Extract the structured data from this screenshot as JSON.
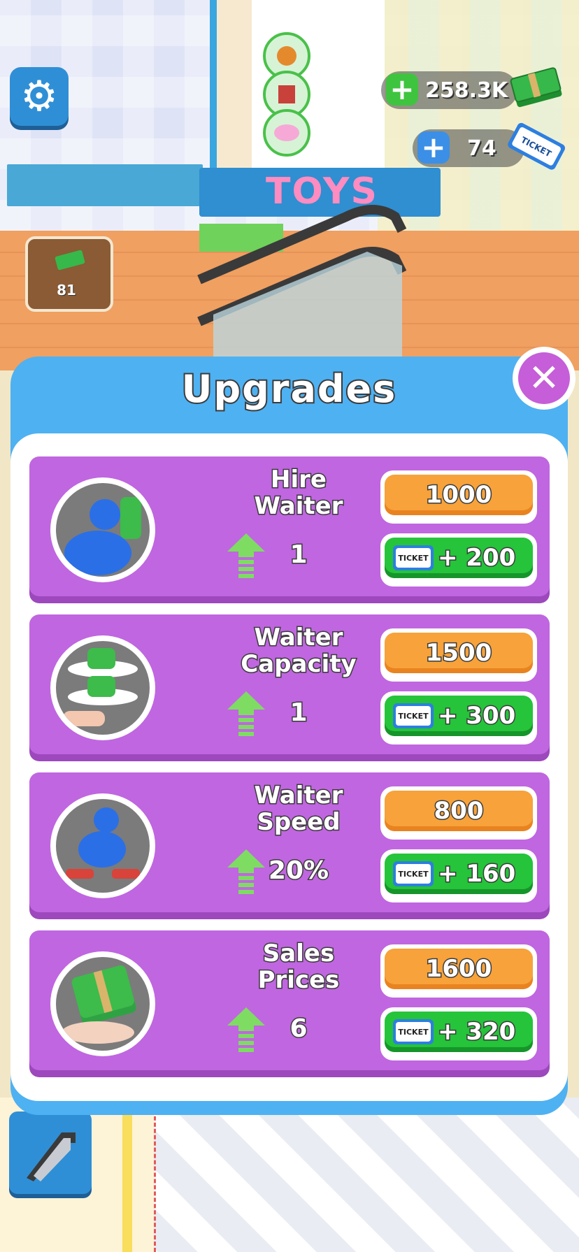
{
  "hud": {
    "money": "258.3K",
    "tickets": "74",
    "cash_stack_count": "81",
    "sign_text": "TOYS",
    "ticket_icon_text": "TICKET"
  },
  "modal": {
    "title": "Upgrades",
    "upgrades": [
      {
        "name_line1": "Hire",
        "name_line2": "Waiter",
        "level": "1",
        "price": "1000",
        "ticket_label": "TICKET",
        "ticket_reward": "+ 200"
      },
      {
        "name_line1": "Waiter",
        "name_line2": "Capacity",
        "level": "1",
        "price": "1500",
        "ticket_label": "TICKET",
        "ticket_reward": "+ 300"
      },
      {
        "name_line1": "Waiter",
        "name_line2": "Speed",
        "level": "20%",
        "price": "800",
        "ticket_label": "TICKET",
        "ticket_reward": "+ 160"
      },
      {
        "name_line1": "Sales",
        "name_line2": "Prices",
        "level": "6",
        "price": "1600",
        "ticket_label": "TICKET",
        "ticket_reward": "+ 320"
      }
    ]
  },
  "colors": {
    "modal_blue": "#4eb1f2",
    "card_purple": "#c066e0",
    "price_orange": "#f7a23a",
    "ticket_green": "#25c43a",
    "close_purple": "#c55ed8"
  },
  "icons": {
    "settings": "gear-icon",
    "money_add": "plus-icon",
    "ticket_add": "plus-icon",
    "close": "close-icon",
    "upgrade_arrow": "arrow-up-icon",
    "escalator": "escalator-icon"
  }
}
